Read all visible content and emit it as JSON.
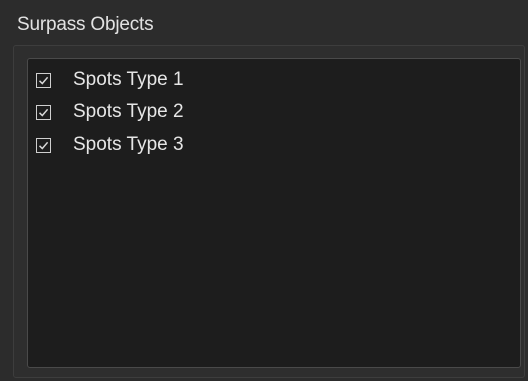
{
  "panel": {
    "title": "Surpass Objects"
  },
  "objects": [
    {
      "label": "Spots Type 1",
      "checked": true
    },
    {
      "label": "Spots Type 2",
      "checked": true
    },
    {
      "label": "Spots Type 3",
      "checked": true
    }
  ],
  "colors": {
    "panel_bg": "#2c2c2c",
    "list_bg": "#1d1d1d",
    "text": "#e6e6e6",
    "checkbox_border": "#cfcfcf"
  },
  "icons": {
    "checkbox_checked": "checkmark-icon"
  }
}
